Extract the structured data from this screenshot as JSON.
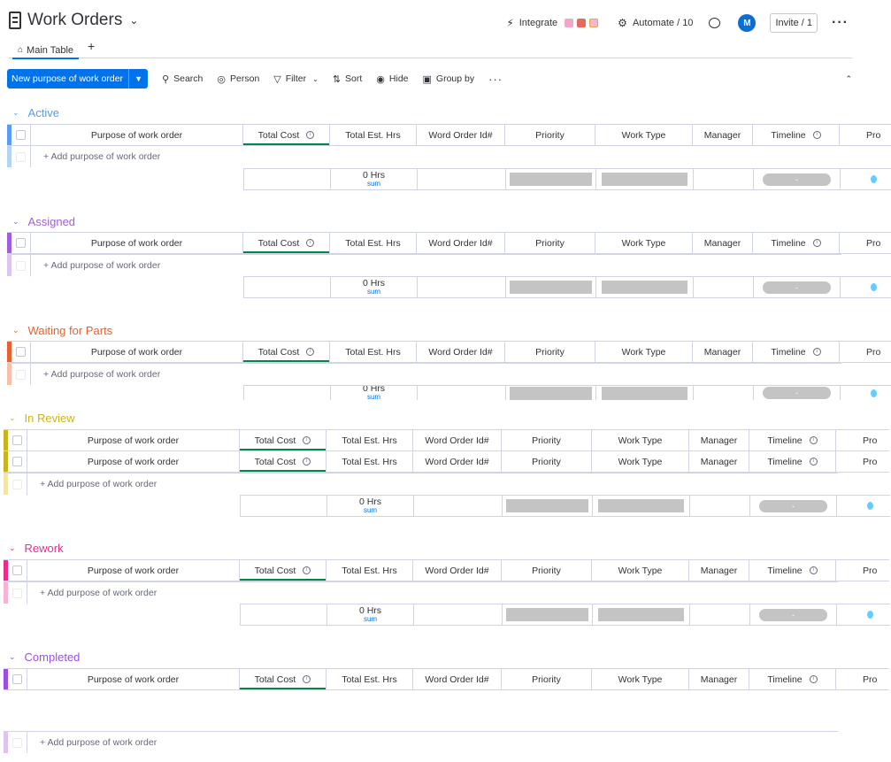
{
  "header": {
    "board_title": "Work Orders",
    "integrate_label": "Integrate",
    "automate_label": "Automate / 10",
    "avatar_initial": "M",
    "invite_label": "Invite / 1"
  },
  "tabs": {
    "main_table": "Main Table",
    "add": "+"
  },
  "toolbar": {
    "new_button": "New purpose of work order",
    "search": "Search",
    "person": "Person",
    "filter": "Filter",
    "sort": "Sort",
    "hide": "Hide",
    "group_by": "Group by"
  },
  "columns": {
    "name": "Purpose of work order",
    "cost": "Total Cost",
    "hrs": "Total Est. Hrs",
    "wo": "Word Order Id#",
    "prio": "Priority",
    "wt": "Work Type",
    "mgr": "Manager",
    "tl": "Timeline",
    "pr": "Pro"
  },
  "add_row_label": "+ Add purpose of work order",
  "summary": {
    "hrs": "0 Hrs",
    "sum_label": "sum",
    "timeline": "-"
  },
  "groups": [
    {
      "title": "Active",
      "color": "#579bfc",
      "light": "#b3d4f5"
    },
    {
      "title": "Assigned",
      "color": "#a25ddc",
      "light": "#dcc3f0"
    },
    {
      "title": "Waiting for Parts",
      "color": "#e8612c",
      "light": "#f5bfa8"
    },
    {
      "title": "In Review",
      "color": "#c9b51b",
      "light": "#efe6a8"
    },
    {
      "title": "Rework",
      "color": "#ec2b91",
      "light": "#f7b3d6"
    },
    {
      "title": "Completed",
      "color": "#9d50dd",
      "light": "#dcc3f0"
    }
  ]
}
